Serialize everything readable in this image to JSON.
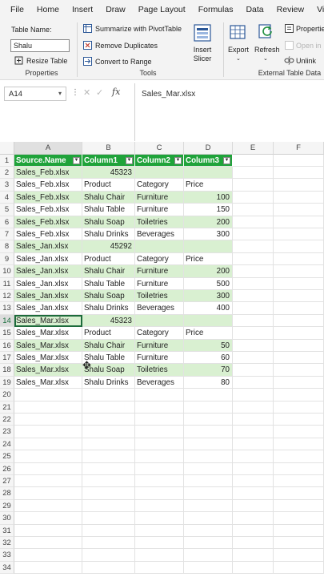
{
  "menu": [
    "File",
    "Home",
    "Insert",
    "Draw",
    "Page Layout",
    "Formulas",
    "Data",
    "Review",
    "View"
  ],
  "ribbon": {
    "table_name_label": "Table Name:",
    "table_name_value": "Shalu",
    "resize_table": "Resize Table",
    "properties_group": "Properties",
    "summarize_pivot": "Summarize with PivotTable",
    "remove_duplicates": "Remove Duplicates",
    "convert_to_range": "Convert to Range",
    "tools_group": "Tools",
    "insert_slicer": "Insert Slicer",
    "export": "Export",
    "refresh": "Refresh",
    "properties_btn": "Properties",
    "open_in": "Open in",
    "unlink": "Unlink",
    "external_group": "External Table Data"
  },
  "formula_bar": {
    "name_box": "A14",
    "formula_value": "Sales_Mar.xlsx"
  },
  "columns": [
    "A",
    "B",
    "C",
    "D",
    "E",
    "F"
  ],
  "header_row": {
    "row_num": "1",
    "cells": [
      "Source.Name",
      "Column1",
      "Column2",
      "Column3"
    ]
  },
  "rows": [
    {
      "n": "2",
      "a": "Sales_Feb.xlsx",
      "b": "45323",
      "c": "",
      "d": "",
      "band": "band"
    },
    {
      "n": "3",
      "a": "Sales_Feb.xlsx",
      "b": "Product",
      "c": "Category",
      "d": "Price",
      "band": "plain"
    },
    {
      "n": "4",
      "a": "Sales_Feb.xlsx",
      "b": "Shalu Chair",
      "c": "Furniture",
      "d": "100",
      "band": "band"
    },
    {
      "n": "5",
      "a": "Sales_Feb.xlsx",
      "b": "Shalu Table",
      "c": "Furniture",
      "d": "150",
      "band": "plain"
    },
    {
      "n": "6",
      "a": "Sales_Feb.xlsx",
      "b": "Shalu Soap",
      "c": "Toiletries",
      "d": "200",
      "band": "band"
    },
    {
      "n": "7",
      "a": "Sales_Feb.xlsx",
      "b": "Shalu Drinks",
      "c": "Beverages",
      "d": "300",
      "band": "plain"
    },
    {
      "n": "8",
      "a": "Sales_Jan.xlsx",
      "b": "45292",
      "c": "",
      "d": "",
      "band": "band"
    },
    {
      "n": "9",
      "a": "Sales_Jan.xlsx",
      "b": "Product",
      "c": "Category",
      "d": "Price",
      "band": "plain"
    },
    {
      "n": "10",
      "a": "Sales_Jan.xlsx",
      "b": "Shalu Chair",
      "c": "Furniture",
      "d": "200",
      "band": "band"
    },
    {
      "n": "11",
      "a": "Sales_Jan.xlsx",
      "b": "Shalu Table",
      "c": "Furniture",
      "d": "500",
      "band": "plain"
    },
    {
      "n": "12",
      "a": "Sales_Jan.xlsx",
      "b": "Shalu Soap",
      "c": "Toiletries",
      "d": "300",
      "band": "band"
    },
    {
      "n": "13",
      "a": "Sales_Jan.xlsx",
      "b": "Shalu Drinks",
      "c": "Beverages",
      "d": "400",
      "band": "plain"
    },
    {
      "n": "14",
      "a": "Sales_Mar.xlsx",
      "b": "45323",
      "c": "",
      "d": "",
      "band": "band"
    },
    {
      "n": "15",
      "a": "Sales_Mar.xlsx",
      "b": "Product",
      "c": "Category",
      "d": "Price",
      "band": "plain"
    },
    {
      "n": "16",
      "a": "Sales_Mar.xlsx",
      "b": "Shalu Chair",
      "c": "Furniture",
      "d": "50",
      "band": "band"
    },
    {
      "n": "17",
      "a": "Sales_Mar.xlsx",
      "b": "Shalu Table",
      "c": "Furniture",
      "d": "60",
      "band": "plain"
    },
    {
      "n": "18",
      "a": "Sales_Mar.xlsx",
      "b": "Shalu Soap",
      "c": "Toiletries",
      "d": "70",
      "band": "band"
    },
    {
      "n": "19",
      "a": "Sales_Mar.xlsx",
      "b": "Shalu Drinks",
      "c": "Beverages",
      "d": "80",
      "band": "plain"
    }
  ],
  "empty_rows": [
    "20",
    "21",
    "22",
    "23",
    "24",
    "25",
    "26",
    "27",
    "28",
    "29",
    "30",
    "31",
    "32",
    "33",
    "34"
  ],
  "active_cell": "A14",
  "colors": {
    "header_green": "#1fa33a",
    "band_green": "#d9f0d1",
    "accent": "#1d6b3b"
  }
}
